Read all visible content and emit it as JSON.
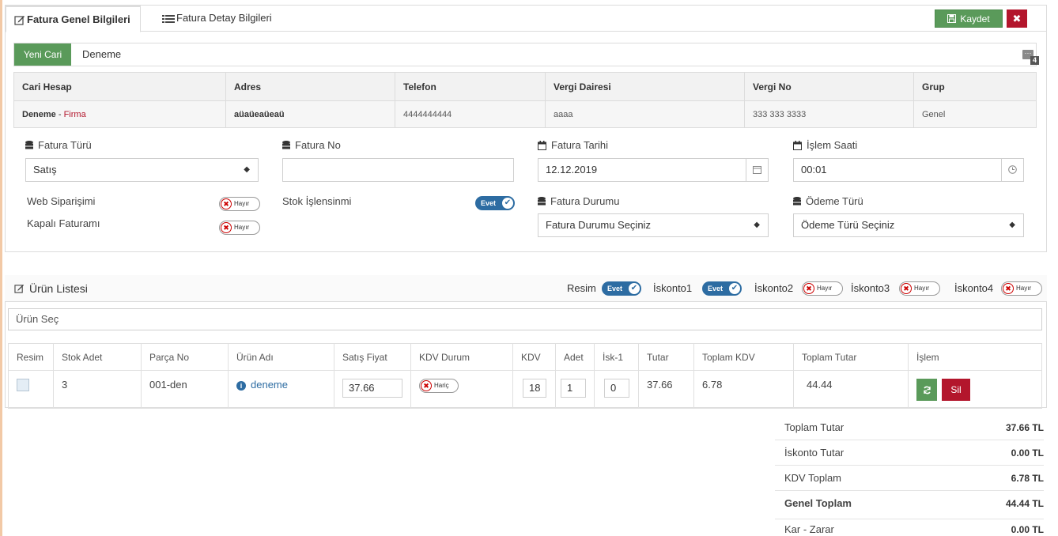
{
  "tabs": [
    {
      "label": "Fatura Genel Bilgileri",
      "icon": "edit-icon",
      "active": true
    },
    {
      "label": "Fatura Detay Bilgileri",
      "icon": "list-icon",
      "active": false
    }
  ],
  "toolbar": {
    "save_label": "Kaydet",
    "close_label": "✖"
  },
  "cari": {
    "new_button": "Yeni Cari",
    "name": "Deneme",
    "more_label": "···",
    "badge": "4"
  },
  "info_table": {
    "headers": [
      "Cari Hesap",
      "Adres",
      "Telefon",
      "Vergi Dairesi",
      "Vergi No",
      "Grup"
    ],
    "row": {
      "cari": "Deneme",
      "cari_sep": " - ",
      "cari_type": "Firma",
      "adres": "aüaüeaüeaü",
      "telefon": "4444444444",
      "vergi_dairesi": "aaaa",
      "vergi_no": "333 333 3333",
      "grup": "Genel"
    }
  },
  "form": {
    "fatura_turu": {
      "label": "Fatura Türü",
      "value": "Satış"
    },
    "fatura_no": {
      "label": "Fatura No",
      "value": ""
    },
    "fatura_tarihi": {
      "label": "Fatura Tarihi",
      "value": "12.12.2019"
    },
    "islem_saati": {
      "label": "İşlem Saati",
      "value": "00:01"
    },
    "web_siparisi": {
      "label": "Web Siparişimi",
      "toggle": "Hayır"
    },
    "kapali_fatura": {
      "label": "Kapalı Faturamı",
      "toggle": "Hayır"
    },
    "stok_islensin": {
      "label": "Stok İşlensinmi",
      "toggle": "Evet"
    },
    "fatura_durumu": {
      "label": "Fatura Durumu",
      "value": "Fatura Durumu Seçiniz"
    },
    "odeme_turu": {
      "label": "Ödeme Türü",
      "value": "Ödeme Türü Seçiniz"
    }
  },
  "products": {
    "title": "Ürün Listesi",
    "options": [
      {
        "label": "Resim",
        "toggle": "Evet"
      },
      {
        "label": "İskonto1",
        "toggle": "Evet"
      },
      {
        "label": "İskonto2",
        "toggle": "Hayır"
      },
      {
        "label": "İskonto3",
        "toggle": "Hayır"
      },
      {
        "label": "İskonto4",
        "toggle": "Hayır"
      }
    ],
    "select_placeholder": "Ürün Seç",
    "headers": [
      "Resim",
      "Stok Adet",
      "Parça No",
      "Ürün Adı",
      "Satış Fiyat",
      "KDV Durum",
      "KDV",
      "Adet",
      "İsk-1",
      "Tutar",
      "Toplam KDV",
      "Toplam Tutar",
      "İşlem"
    ],
    "rows": [
      {
        "stok": "3",
        "parca": "001-den",
        "urun": "deneme",
        "fiyat": "37.66",
        "kdv_durum": "Hariç",
        "kdv": "18",
        "adet": "1",
        "isk": "0",
        "tutar": "37.66",
        "toplam_kdv": "6.78",
        "toplam_tutar": "44.44",
        "delete_label": "Sil"
      }
    ]
  },
  "summary": [
    {
      "label": "Toplam Tutar",
      "value": "37.66 TL"
    },
    {
      "label": "İskonto Tutar",
      "value": "0.00 TL"
    },
    {
      "label": "KDV Toplam",
      "value": "6.78 TL"
    },
    {
      "label": "Genel Toplam",
      "value": "44.44 TL"
    },
    {
      "label": "Kar - Zarar",
      "value": "0.00 TL"
    }
  ],
  "colors": {
    "success": "#5a9a5a",
    "danger": "#b3162c",
    "primary": "#2d6ca2"
  }
}
